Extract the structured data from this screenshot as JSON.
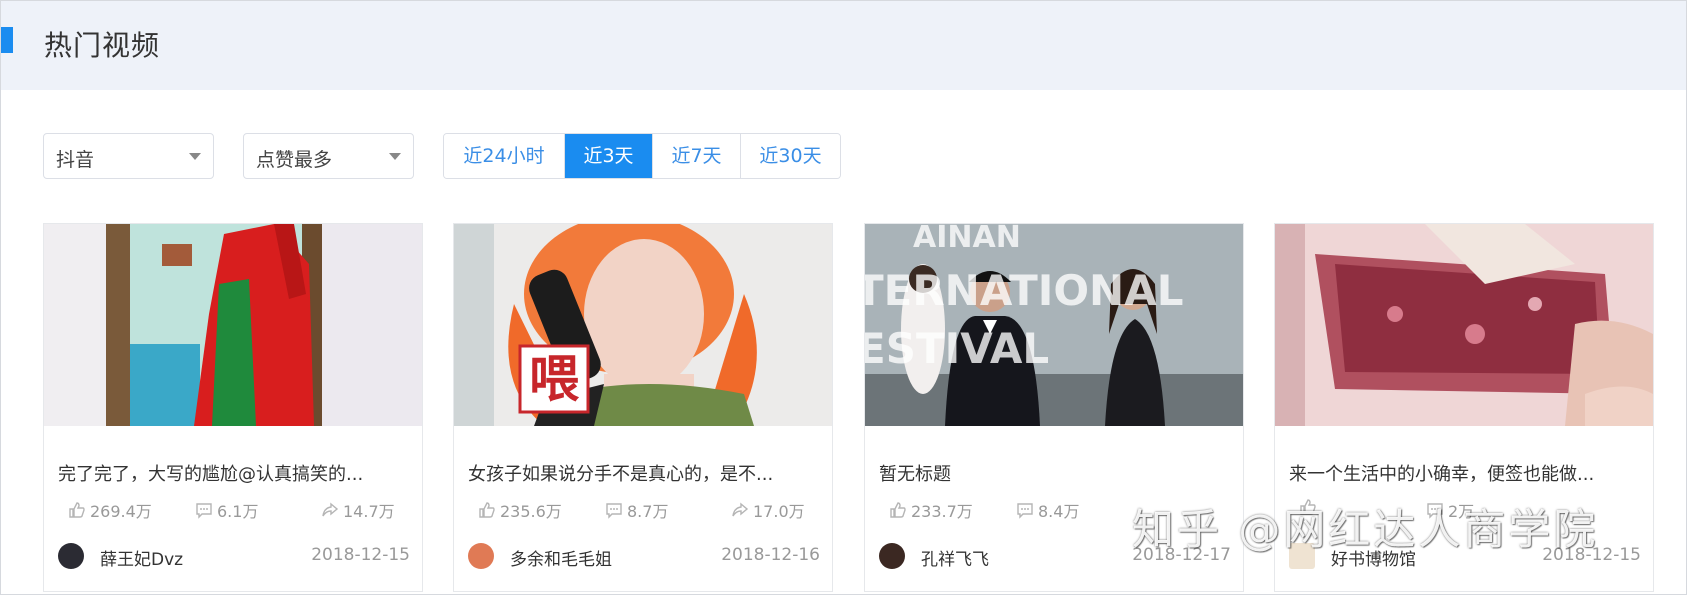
{
  "header": {
    "title": "热门视频"
  },
  "filters": {
    "platform": "抖音",
    "sort": "点赞最多",
    "ranges": [
      "近24小时",
      "近3天",
      "近7天",
      "近30天"
    ],
    "active_range": "近3天"
  },
  "videos": [
    {
      "title": "完了完了，大写的尴尬@认真搞笑的...",
      "likes": "269.4万",
      "comments": "6.1万",
      "shares": "14.7万",
      "author": "薛王妃Dvz",
      "date": "2018-12-15"
    },
    {
      "title": "女孩子如果说分手不是真心的，是不...",
      "likes": "235.6万",
      "comments": "8.7万",
      "shares": "17.0万",
      "author": "多余和毛毛姐",
      "date": "2018-12-16",
      "overlay_text": "喂"
    },
    {
      "title": "暂无标题",
      "likes": "233.7万",
      "comments": "8.4万",
      "shares": "",
      "author": "孔祥飞飞",
      "date": "2018-12-17",
      "backdrop_text": [
        "AINAN",
        "TERNATIONAL",
        "ESTIVAL"
      ]
    },
    {
      "title": "来一个生活中的小确幸，便签也能做...",
      "likes": "",
      "comments": "2万",
      "shares": "",
      "author": "好书博物馆",
      "date": "2018-12-15"
    }
  ],
  "watermark": "知乎 @网红达人商学院",
  "colors": {
    "accent": "#1a8cf0",
    "header_bg": "#eef2f9"
  }
}
